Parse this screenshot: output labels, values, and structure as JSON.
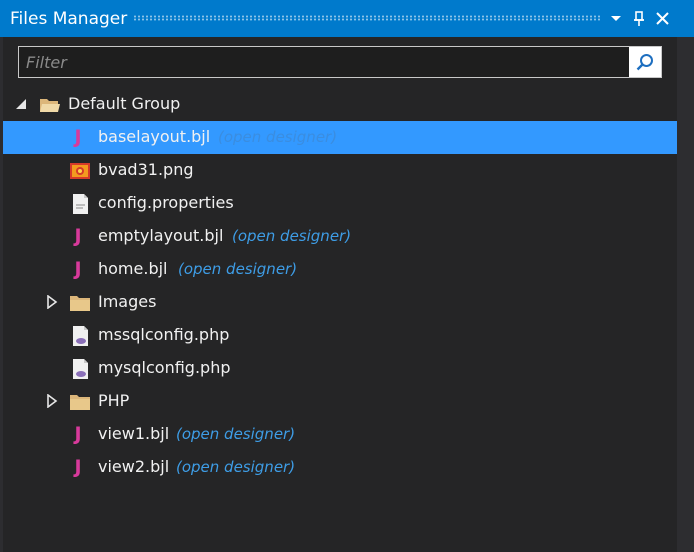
{
  "panel": {
    "title": "Files Manager",
    "buttons": [
      "window-position-dropdown",
      "pin",
      "close"
    ]
  },
  "filter": {
    "placeholder": "Filter",
    "value": ""
  },
  "tree": {
    "group": {
      "label": "Default Group",
      "expanded": true
    },
    "items": [
      {
        "label": "baselayout.bjl",
        "icon": "bjl-file-icon",
        "hint": "(open designer)",
        "selected": true
      },
      {
        "label": "bvad31.png",
        "icon": "image-file-icon",
        "hint": ""
      },
      {
        "label": "config.properties",
        "icon": "text-file-icon",
        "hint": ""
      },
      {
        "label": "emptylayout.bjl",
        "icon": "bjl-file-icon",
        "hint": "(open designer)"
      },
      {
        "label": "home.bjl",
        "icon": "bjl-file-icon",
        "hint": "(open designer)"
      },
      {
        "label": "Images",
        "icon": "folder-icon",
        "hint": "",
        "folder": true
      },
      {
        "label": "mssqlconfig.php",
        "icon": "php-file-icon",
        "hint": ""
      },
      {
        "label": "mysqlconfig.php",
        "icon": "php-file-icon",
        "hint": ""
      },
      {
        "label": "PHP",
        "icon": "folder-icon",
        "hint": "",
        "folder": true
      },
      {
        "label": "view1.bjl",
        "icon": "bjl-file-icon",
        "hint": "(open designer)"
      },
      {
        "label": "view2.bjl",
        "icon": "bjl-file-icon",
        "hint": "(open designer)"
      }
    ]
  },
  "colors": {
    "titlebar": "#007acc",
    "selection": "#3399ff",
    "hint": "#3e9de6",
    "bjl_icon": "#d83a9b",
    "background": "#252526"
  }
}
